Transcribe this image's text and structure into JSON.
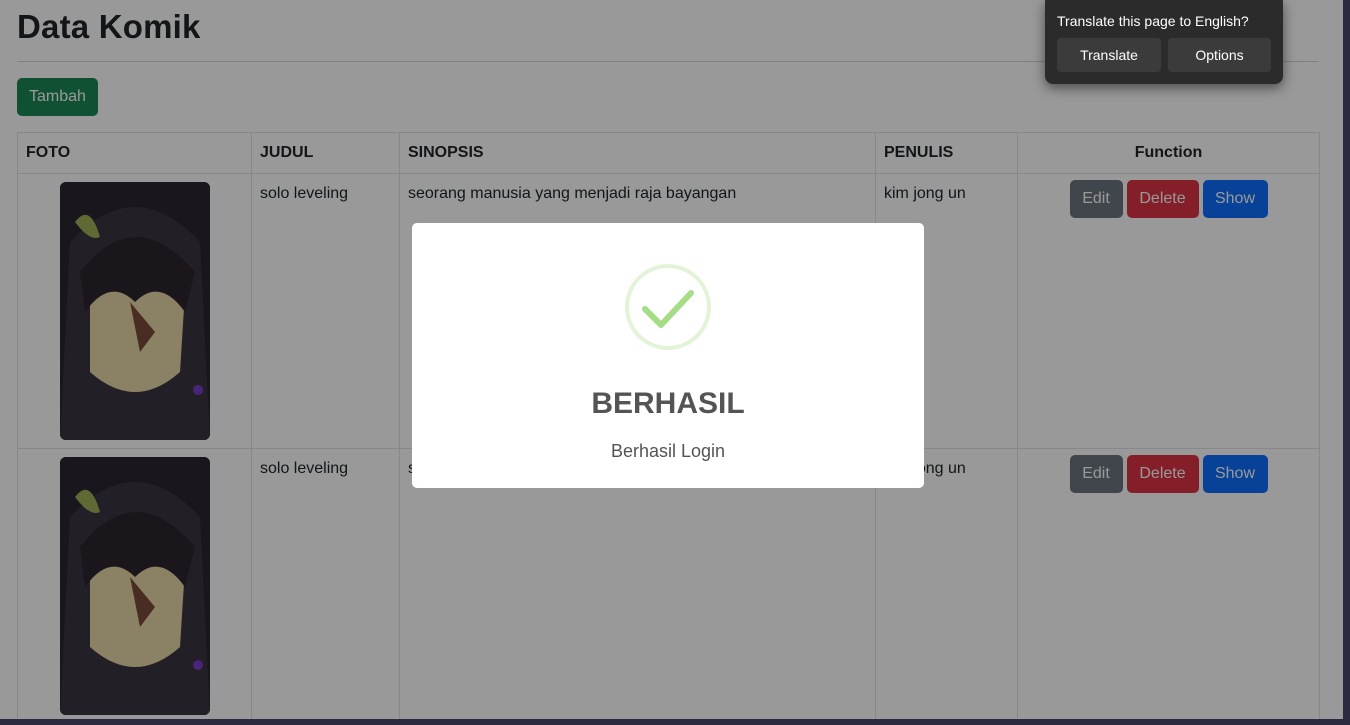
{
  "page": {
    "title": "Data Komik"
  },
  "toolbar": {
    "add_label": "Tambah"
  },
  "table": {
    "headers": [
      "FOTO",
      "JUDUL",
      "SINOPSIS",
      "PENULIS",
      "Function"
    ],
    "rows": [
      {
        "judul": "solo leveling",
        "sinopsis": "seorang manusia yang menjadi raja bayangan",
        "penulis": "kim jong un"
      },
      {
        "judul": "solo leveling",
        "sinopsis": "seorang manusia yang menjadi raja bayangan",
        "penulis": "kim jong un"
      }
    ],
    "actions": {
      "edit": "Edit",
      "delete": "Delete",
      "show": "Show"
    }
  },
  "modal": {
    "title": "BERHASIL",
    "text": "Berhasil Login",
    "icon": "check-icon",
    "icon_color": "#a5dc86"
  },
  "translate": {
    "prompt": "Translate this page to English?",
    "translate_label": "Translate",
    "options_label": "Options"
  },
  "colors": {
    "success": "#198754",
    "secondary": "#6c757d",
    "danger": "#dc3545",
    "primary": "#0d6efd"
  }
}
